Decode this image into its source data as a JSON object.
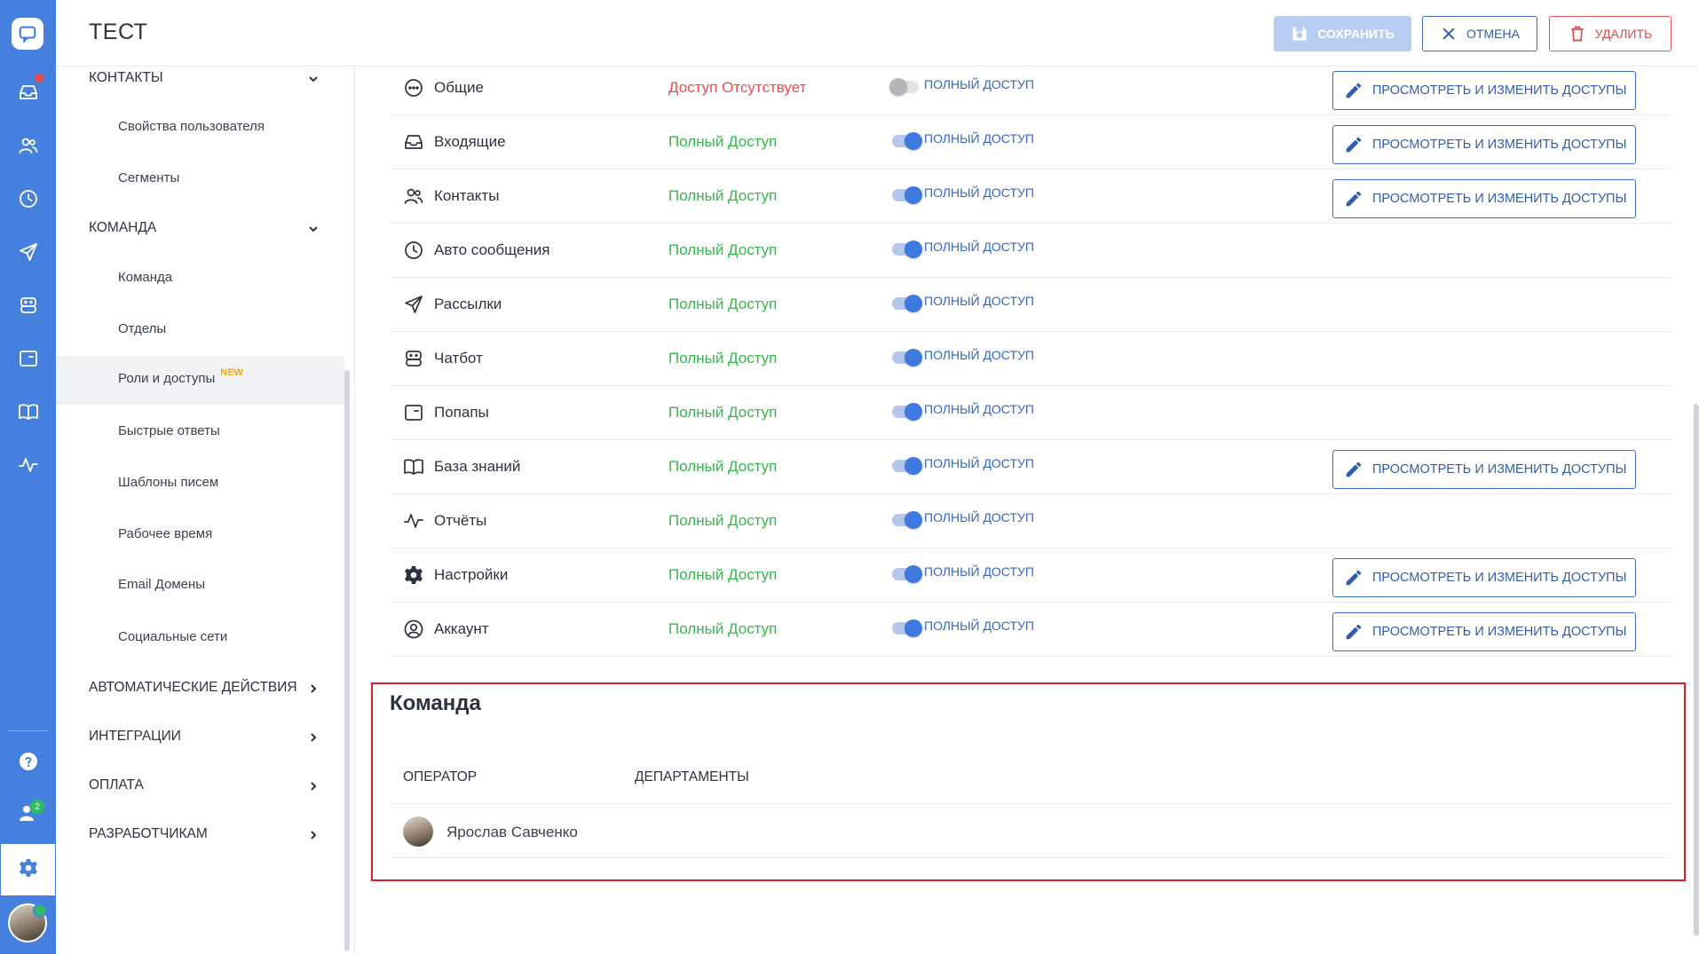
{
  "header": {
    "title": "ТЕСТ",
    "save_label": "СОХРАНИТЬ",
    "cancel_label": "ОТМЕНА",
    "delete_label": "УДАЛИТЬ"
  },
  "rail": {
    "items": [
      {
        "icon": "inbox-icon"
      },
      {
        "icon": "contacts-icon"
      },
      {
        "icon": "clock-icon"
      },
      {
        "icon": "send-icon"
      },
      {
        "icon": "chatbot-icon"
      },
      {
        "icon": "popup-icon"
      },
      {
        "icon": "book-icon"
      },
      {
        "icon": "pulse-icon"
      }
    ],
    "team_badge": "2",
    "colors": {
      "rail": "#4680df",
      "notify": "#f24b4b",
      "online": "#2ebd5f"
    }
  },
  "sidebar": {
    "contacts_group": "КОНТАКТЫ",
    "contacts_items": [
      "Свойства пользователя",
      "Сегменты"
    ],
    "team_group": "КОМАНДА",
    "team_items": [
      "Команда",
      "Отделы",
      "Роли и доступы",
      "Быстрые ответы",
      "Шаблоны писем",
      "Рабочее время",
      "Email Домены",
      "Социальные сети"
    ],
    "new_tag": "NEW",
    "other_groups": [
      "АВТОМАТИЧЕСКИЕ ДЕЙСТВИЯ",
      "ИНТЕГРАЦИИ",
      "ОПЛАТА",
      "РАЗРАБОТЧИКАМ"
    ]
  },
  "permissions": {
    "toggle_label": "ПОЛНЫЙ ДОСТУП",
    "edit_label": "ПРОСМОТРЕТЬ И ИЗМЕНИТЬ ДОСТУПЫ",
    "status_full_color": "#33b84a",
    "status_none_color": "#ee4c4c",
    "rows": [
      {
        "icon": "smile-icon",
        "name": "Общие",
        "status": "Доступ Отсутствует",
        "enabled": false,
        "editable": true
      },
      {
        "icon": "inbox-icon",
        "name": "Входящие",
        "status": "Полный Доступ",
        "enabled": true,
        "editable": true
      },
      {
        "icon": "contacts-icon",
        "name": "Контакты",
        "status": "Полный Доступ",
        "enabled": true,
        "editable": true
      },
      {
        "icon": "clock-icon",
        "name": "Авто сообщения",
        "status": "Полный Доступ",
        "enabled": true,
        "editable": false
      },
      {
        "icon": "send-icon",
        "name": "Рассылки",
        "status": "Полный Доступ",
        "enabled": true,
        "editable": false
      },
      {
        "icon": "chatbot-icon",
        "name": "Чатбот",
        "status": "Полный Доступ",
        "enabled": true,
        "editable": false
      },
      {
        "icon": "popup-icon",
        "name": "Попапы",
        "status": "Полный Доступ",
        "enabled": true,
        "editable": false
      },
      {
        "icon": "book-icon",
        "name": "База знаний",
        "status": "Полный Доступ",
        "enabled": true,
        "editable": true
      },
      {
        "icon": "pulse-icon",
        "name": "Отчёты",
        "status": "Полный Доступ",
        "enabled": true,
        "editable": false
      },
      {
        "icon": "gear-icon",
        "name": "Настройки",
        "status": "Полный Доступ",
        "enabled": true,
        "editable": true
      },
      {
        "icon": "user-circle-icon",
        "name": "Аккаунт",
        "status": "Полный Доступ",
        "enabled": true,
        "editable": true
      }
    ]
  },
  "team": {
    "title": "Команда",
    "col_operator": "ОПЕРАТОР",
    "col_departments": "ДЕПАРТАМЕНТЫ",
    "members": [
      {
        "name": "Ярослав Савченко"
      }
    ]
  }
}
